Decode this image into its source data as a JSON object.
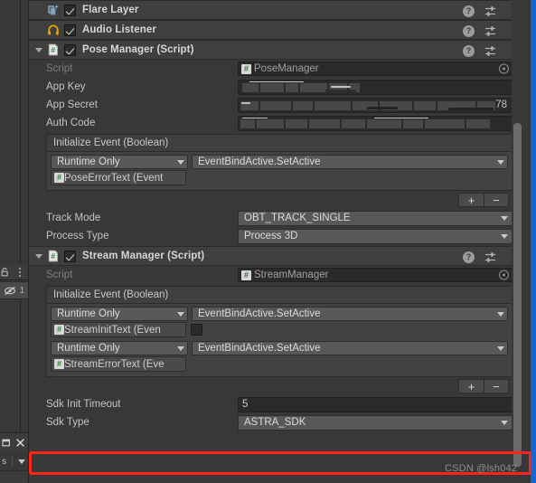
{
  "window": {
    "title": "Inspector",
    "accent_color": "#1564d0",
    "annotation_color": "#ff2419"
  },
  "watermark": {
    "text": "CSDN @lsh042"
  },
  "left_gutter": {
    "lock_icon": "lock-icon",
    "kebab_icon": "kebab-menu-icon",
    "hidden_count": "1",
    "hidden_icon": "eye-slash-icon",
    "window_icon": "window-icon",
    "close_icon": "close-icon",
    "tab_label": "s",
    "tab_caret": "chevron-down-icon"
  },
  "header_icons": {
    "help": "?",
    "help_name": "help-icon",
    "preset": "preset-icon",
    "kebab": "kebab-menu-icon"
  },
  "components": [
    {
      "id": "flare-layer",
      "title": "Flare Layer",
      "icon": "flare-layer-icon",
      "enabled": true,
      "expanded": false,
      "has_foldout": false
    },
    {
      "id": "audio-listener",
      "title": "Audio Listener",
      "icon": "audio-listener-icon",
      "enabled": true,
      "expanded": false,
      "has_foldout": false
    },
    {
      "id": "pose-manager",
      "title": "Pose Manager (Script)",
      "icon": "cs-script-icon",
      "enabled": true,
      "expanded": true,
      "has_foldout": true
    },
    {
      "id": "stream-manager",
      "title": "Stream Manager (Script)",
      "icon": "cs-script-icon",
      "enabled": true,
      "expanded": true,
      "has_foldout": true
    }
  ],
  "pose_manager": {
    "script": {
      "label": "Script",
      "value": "PoseManager",
      "picker": "object-picker-icon"
    },
    "app_key": {
      "label": "App Key",
      "value": "",
      "redacted": true
    },
    "app_secret": {
      "label": "App Secret",
      "value": "",
      "redacted": true,
      "tail": "78"
    },
    "auth_code": {
      "label": "Auth Code",
      "value": "",
      "redacted": true
    },
    "initialize_event": {
      "title": "Initialize Event (Boolean)",
      "entries": [
        {
          "mode": "Runtime Only",
          "function": "EventBindActive.SetActive",
          "target": "PoseErrorText (Event",
          "bool_arg": null
        }
      ],
      "add_label": "+",
      "remove_label": "−"
    },
    "track_mode": {
      "label": "Track Mode",
      "value": "OBT_TRACK_SINGLE"
    },
    "process_type": {
      "label": "Process Type",
      "value": "Process 3D"
    }
  },
  "stream_manager": {
    "script": {
      "label": "Script",
      "value": "StreamManager",
      "picker": "object-picker-icon"
    },
    "initialize_event": {
      "title": "Initialize Event (Boolean)",
      "entries": [
        {
          "mode": "Runtime Only",
          "function": "EventBindActive.SetActive",
          "target": "StreamInitText (Even",
          "bool_arg": false
        },
        {
          "mode": "Runtime Only",
          "function": "EventBindActive.SetActive",
          "target": "StreamErrorText (Eve",
          "bool_arg": null
        }
      ],
      "add_label": "+",
      "remove_label": "−"
    },
    "sdk_init_timeout": {
      "label": "Sdk Init Timeout",
      "value": "5"
    },
    "sdk_type": {
      "label": "Sdk Type",
      "value": "ASTRA_SDK"
    }
  }
}
